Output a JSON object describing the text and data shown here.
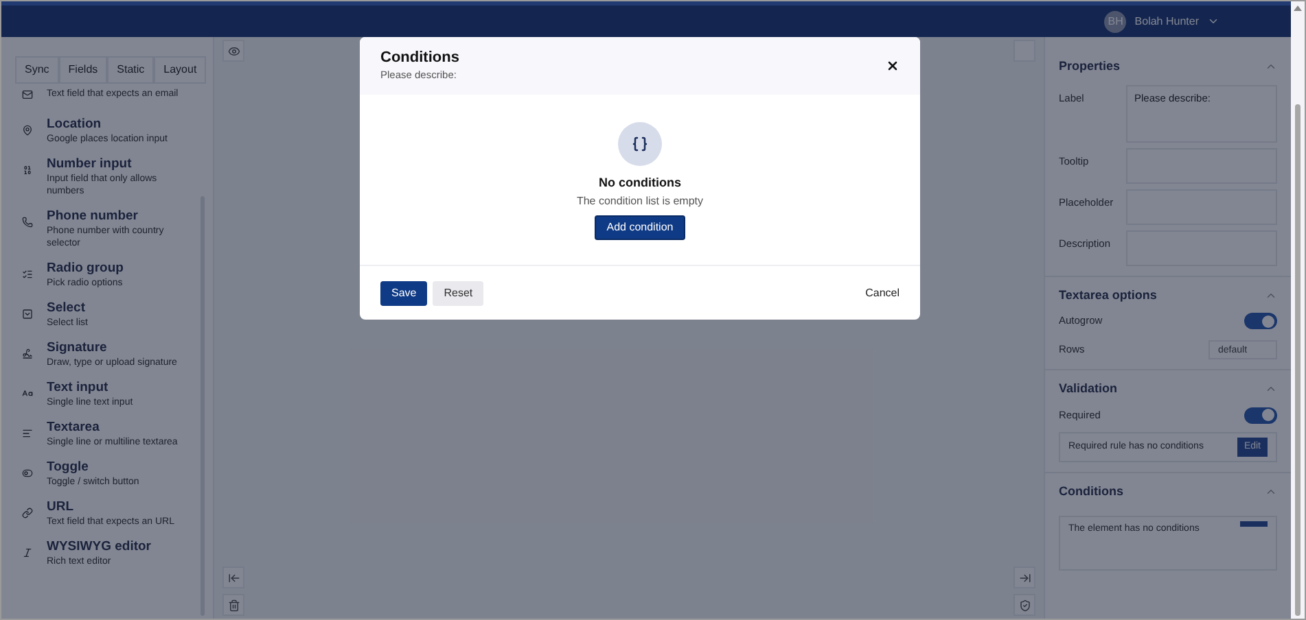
{
  "top_bar": {
    "avatar": "BH",
    "user_name": "Bolah Hunter"
  },
  "sidebar": {
    "tabs": [
      {
        "label": "Sync"
      },
      {
        "label": "Fields"
      },
      {
        "label": "Static"
      },
      {
        "label": "Layout"
      }
    ],
    "items": [
      {
        "kind": "email",
        "description": "Text field that expects an email"
      },
      {
        "kind": "location",
        "title": "Location",
        "description": "Google places location input"
      },
      {
        "kind": "number",
        "title": "Number input",
        "description": "Input field that only allows numbers"
      },
      {
        "kind": "phone",
        "title": "Phone number",
        "description": "Phone number with country selector"
      },
      {
        "kind": "radio",
        "title": "Radio group",
        "description": "Pick radio options"
      },
      {
        "kind": "select",
        "title": "Select",
        "description": "Select list"
      },
      {
        "kind": "signature",
        "title": "Signature",
        "description": "Draw, type or upload signature"
      },
      {
        "kind": "text",
        "title": "Text input",
        "description": "Single line text input"
      },
      {
        "kind": "textarea",
        "title": "Textarea",
        "description": "Single line or multiline textarea"
      },
      {
        "kind": "toggle",
        "title": "Toggle",
        "description": "Toggle / switch button"
      },
      {
        "kind": "url",
        "title": "URL",
        "description": "Text field that expects an URL"
      },
      {
        "kind": "editor",
        "title": "WYSIWYG editor",
        "description": "Rich text editor"
      }
    ]
  },
  "properties": {
    "title": "Properties",
    "fields": [
      {
        "label": "Label",
        "value": "Please describe:"
      },
      {
        "label": "Tooltip"
      },
      {
        "label": "Placeholder"
      },
      {
        "label": "Description"
      }
    ],
    "textarea_options": {
      "title": "Textarea options",
      "autogrow": {
        "label": "Autogrow",
        "on": true
      },
      "rows": {
        "label": "Rows",
        "placeholder": "default"
      }
    },
    "validation": {
      "title": "Validation",
      "required": {
        "label": "Required",
        "on": true
      },
      "rule_note": "Required rule has no conditions",
      "edit_button": "Edit"
    },
    "conditions": {
      "title": "Conditions",
      "note": "The element has no conditions"
    }
  },
  "dialog": {
    "title": "Conditions",
    "subtitle": "Please describe:",
    "empty_title": "No conditions",
    "empty_text": "The condition list is empty",
    "add_button": "Add condition",
    "save_button": "Save",
    "reset_button": "Reset",
    "cancel_button": "Cancel"
  }
}
